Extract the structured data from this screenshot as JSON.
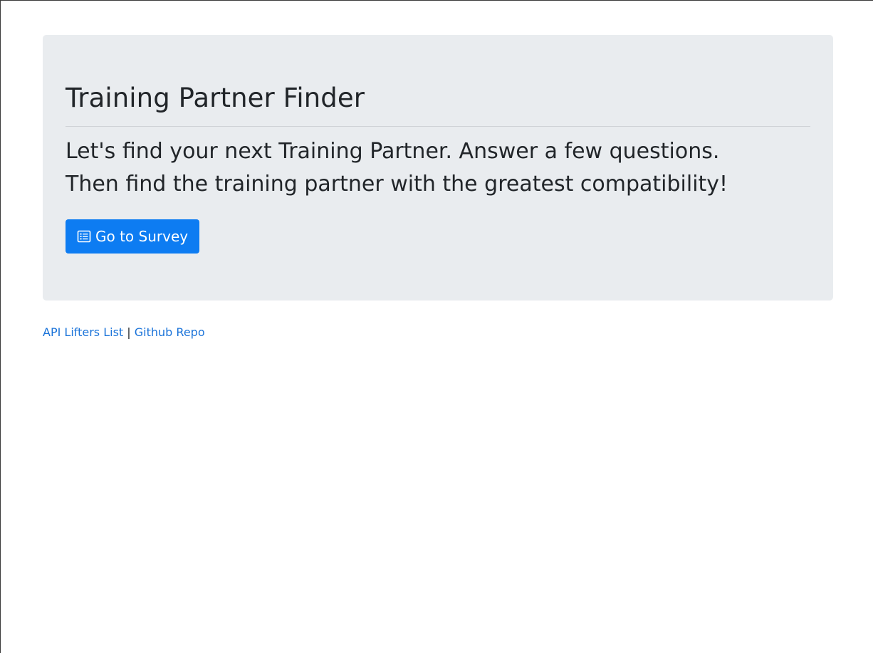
{
  "jumbotron": {
    "title": "Training Partner Finder",
    "lead_line1": "Let's find your next Training Partner. Answer a few questions.",
    "lead_line2": "Then find the training partner with the greatest compatibility!",
    "button_label": "Go to Survey",
    "button_icon": "list-alt-icon"
  },
  "footer": {
    "link_api": "API Lifters List",
    "separator": "|",
    "link_github": "Github Repo"
  },
  "colors": {
    "jumbotron_bg": "#e9ecef",
    "button_bg": "#0d7cf2",
    "link": "#1a73d9",
    "text": "#212529"
  }
}
